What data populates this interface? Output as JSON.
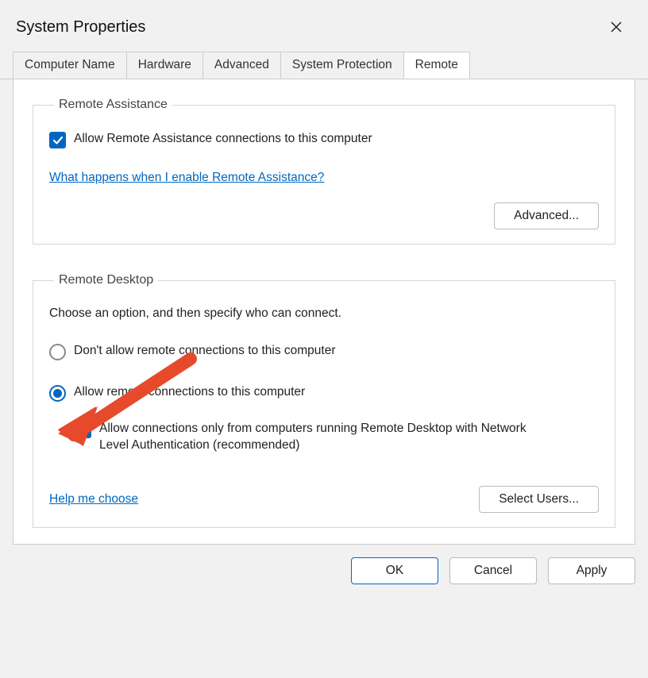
{
  "window": {
    "title": "System Properties"
  },
  "tabs": [
    {
      "label": "Computer Name"
    },
    {
      "label": "Hardware"
    },
    {
      "label": "Advanced"
    },
    {
      "label": "System Protection"
    },
    {
      "label": "Remote"
    }
  ],
  "remote_assistance": {
    "legend": "Remote Assistance",
    "allow_label": "Allow Remote Assistance connections to this computer",
    "what_happens_link": "What happens when I enable Remote Assistance?",
    "advanced_btn": "Advanced..."
  },
  "remote_desktop": {
    "legend": "Remote Desktop",
    "description": "Choose an option, and then specify who can connect.",
    "radio_deny": "Don't allow remote connections to this computer",
    "radio_allow": "Allow remote connections to this computer",
    "nla_label": "Allow connections only from computers running Remote Desktop with Network Level Authentication (recommended)",
    "help_link": "Help me choose",
    "select_users_btn": "Select Users..."
  },
  "footer": {
    "ok": "OK",
    "cancel": "Cancel",
    "apply": "Apply"
  }
}
